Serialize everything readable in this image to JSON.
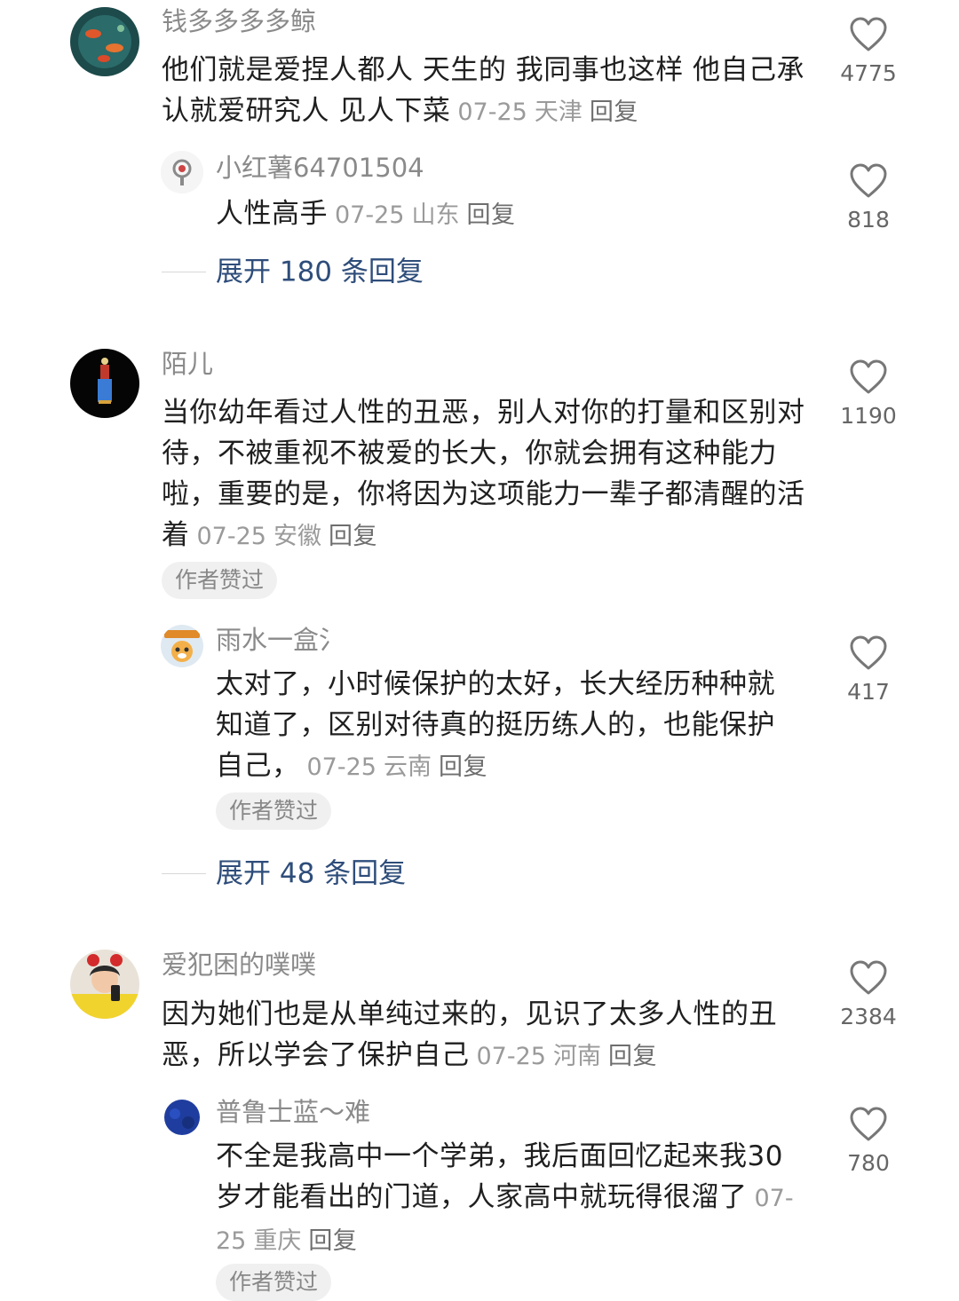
{
  "comments": [
    {
      "username": "钱多多多多鲸",
      "text": "他们就是爱捏人都人 天生的  我同事也这样  他自己承认就爱研究人  见人下菜",
      "date": "07-25",
      "location": "天津",
      "reply_label": "回复",
      "likes": "4775",
      "replies": [
        {
          "username": "小红薯64701504",
          "text": "人性高手",
          "date": "07-25",
          "location": "山东",
          "reply_label": "回复",
          "likes": "818"
        }
      ],
      "expand_label": "展开 180 条回复"
    },
    {
      "username": "陌儿",
      "text": "当你幼年看过人性的丑恶，别人对你的打量和区别对待，不被重视不被爱的长大，你就会拥有这种能力啦，重要的是，你将因为这项能力一辈子都清醒的活着",
      "date": "07-25",
      "location": "安徽",
      "reply_label": "回复",
      "likes": "1190",
      "badge": "作者赞过",
      "replies": [
        {
          "username": "雨水一盒氵",
          "text": "太对了，小时候保护的太好，长大经历种种就知道了，区别对待真的挺历练人的，也能保护自己，",
          "date": "07-25",
          "location": "云南",
          "reply_label": "回复",
          "likes": "417",
          "badge": "作者赞过"
        }
      ],
      "expand_label": "展开 48 条回复"
    },
    {
      "username": "爱犯困的噗噗",
      "text": "因为她们也是从单纯过来的，见识了太多人性的丑恶，所以学会了保护自己",
      "date": "07-25",
      "location": "河南",
      "reply_label": "回复",
      "likes": "2384",
      "replies": [
        {
          "username": "普鲁士蓝～难",
          "text": "不全是我高中一个学弟，我后面回忆起来我30岁才能看出的门道，人家高中就玩得很溜了",
          "date": "07-25",
          "location": "重庆",
          "reply_label": "回复",
          "likes": "780",
          "badge": "作者赞过"
        }
      ]
    }
  ],
  "icons": {
    "like": "heart-outline-icon",
    "divider": "dash-line"
  },
  "colors": {
    "background": "#ffffff",
    "username": "#8a8a8a",
    "body_text": "#1f1f1f",
    "meta": "#9a9a9a",
    "expand_link": "#2e4d7a",
    "badge_bg": "#f0f0f0"
  }
}
